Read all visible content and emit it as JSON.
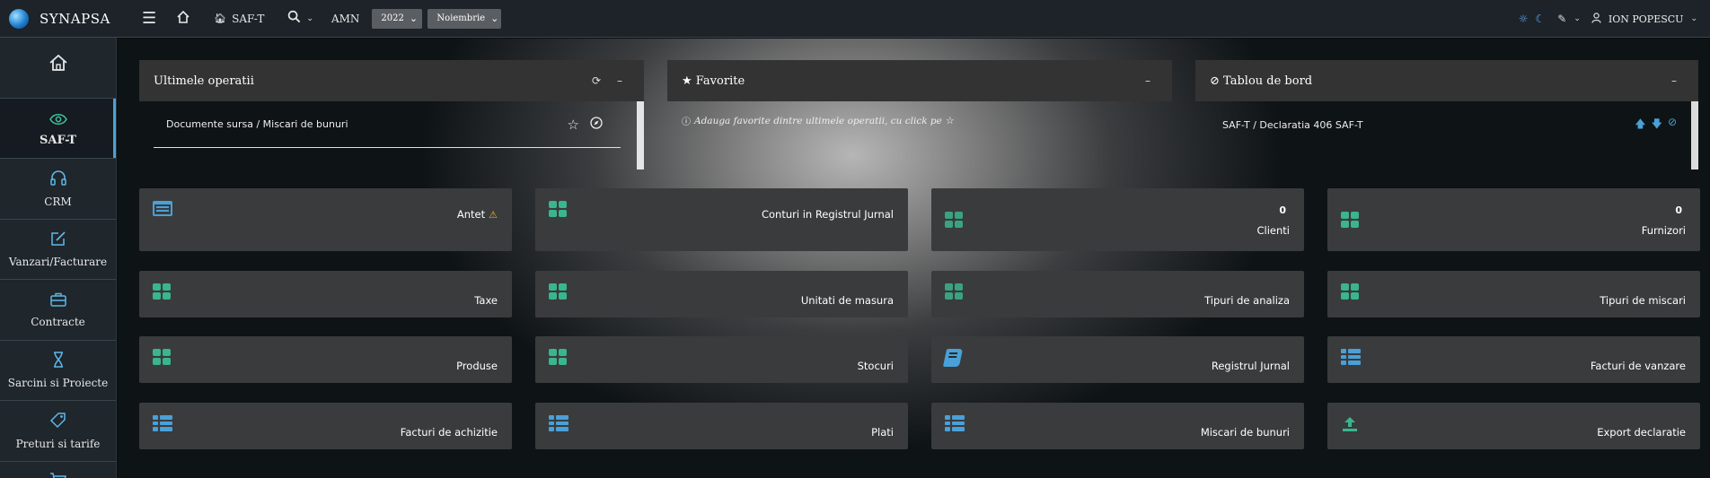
{
  "header": {
    "brand": "SYNAPSA",
    "module": "SAF-T",
    "company": "AMN",
    "year": "2022",
    "month": "Noiembrie",
    "user": "ION POPESCU"
  },
  "sidebar": {
    "items": [
      {
        "label": "",
        "icon": "home-icon"
      },
      {
        "label": "SAF-T",
        "icon": "eye-icon"
      },
      {
        "label": "CRM",
        "icon": "headset-icon"
      },
      {
        "label": "Vanzari/Facturare",
        "icon": "edit-icon"
      },
      {
        "label": "Contracte",
        "icon": "briefcase-icon"
      },
      {
        "label": "Sarcini si Proiecte",
        "icon": "hourglass-icon"
      },
      {
        "label": "Preturi si tarife",
        "icon": "tag-icon"
      },
      {
        "label": "",
        "icon": "cart-icon"
      }
    ]
  },
  "panels": {
    "recent": {
      "title": "Ultimele operatii",
      "items": [
        "Documente sursa / Miscari de bunuri"
      ]
    },
    "favorites": {
      "title": "Favorite",
      "note": "Adauga favorite dintre ultimele operatii, cu click pe"
    },
    "dashboard": {
      "title": "Tablou de bord",
      "items": [
        "SAF-T / Declaratia 406 SAF-T"
      ]
    }
  },
  "cards": [
    {
      "label": "Antet",
      "icon": "window-icon",
      "count": ""
    },
    {
      "label": "Conturi in Registrul Jurnal",
      "icon": "grid-icon",
      "count": ""
    },
    {
      "label": "Clienti",
      "icon": "grid-icon",
      "count": "0"
    },
    {
      "label": "Furnizori",
      "icon": "grid-icon",
      "count": "0"
    },
    {
      "label": "Taxe",
      "icon": "grid-icon",
      "count": ""
    },
    {
      "label": "Unitati de masura",
      "icon": "grid-icon",
      "count": ""
    },
    {
      "label": "Tipuri de analiza",
      "icon": "grid-icon",
      "count": ""
    },
    {
      "label": "Tipuri de miscari",
      "icon": "grid-icon",
      "count": ""
    },
    {
      "label": "Produse",
      "icon": "grid-icon",
      "count": ""
    },
    {
      "label": "Stocuri",
      "icon": "grid-icon",
      "count": ""
    },
    {
      "label": "Registrul Jurnal",
      "icon": "book-icon",
      "count": ""
    },
    {
      "label": "Facturi de vanzare",
      "icon": "list-icon",
      "count": ""
    },
    {
      "label": "Facturi de achizitie",
      "icon": "list-icon",
      "count": ""
    },
    {
      "label": "Plati",
      "icon": "list-icon",
      "count": ""
    },
    {
      "label": "Miscari de bunuri",
      "icon": "list-icon",
      "count": ""
    },
    {
      "label": "Export declaratie",
      "icon": "upload-icon",
      "count": ""
    }
  ],
  "colors": {
    "accent_green": "#3ab58d",
    "accent_blue": "#4aa0d8",
    "warning": "#f0b020"
  }
}
